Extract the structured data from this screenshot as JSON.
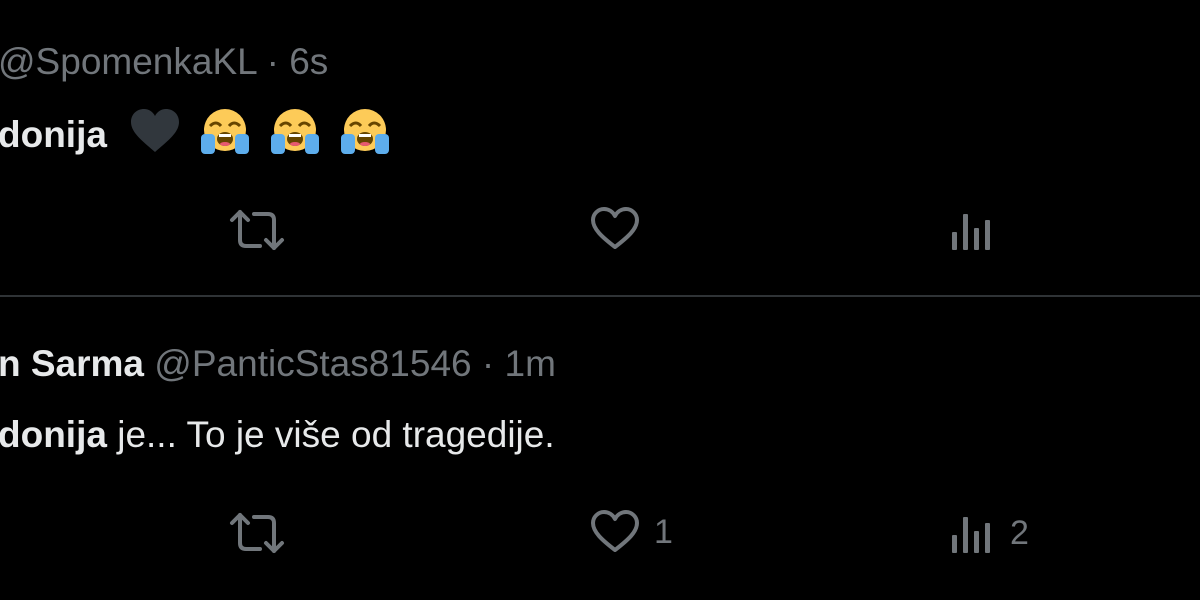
{
  "tweets": [
    {
      "display_name": "",
      "handle": "@SpomenkaKL",
      "separator": "·",
      "time": "6s",
      "text_bold": "donija",
      "text_rest": "",
      "emojis": [
        "black-heart",
        "loudly-crying-face",
        "loudly-crying-face",
        "loudly-crying-face"
      ],
      "actions": {
        "retweet_count": "",
        "like_count": "",
        "views_count": ""
      }
    },
    {
      "display_name": "n Sarma",
      "handle": "@PanticStas81546",
      "separator": "·",
      "time": "1m",
      "text_bold": "donija",
      "text_rest": " je... To je više od tragedije.",
      "emojis": [],
      "actions": {
        "retweet_count": "",
        "like_count": "1",
        "views_count": "2"
      }
    }
  ],
  "icons": {
    "retweet": "retweet-icon",
    "like": "heart-icon",
    "views": "bar-chart-icon"
  },
  "colors": {
    "background": "#000000",
    "text_primary": "#e7e9ea",
    "text_secondary": "#71767b",
    "divider": "#2f3336"
  }
}
